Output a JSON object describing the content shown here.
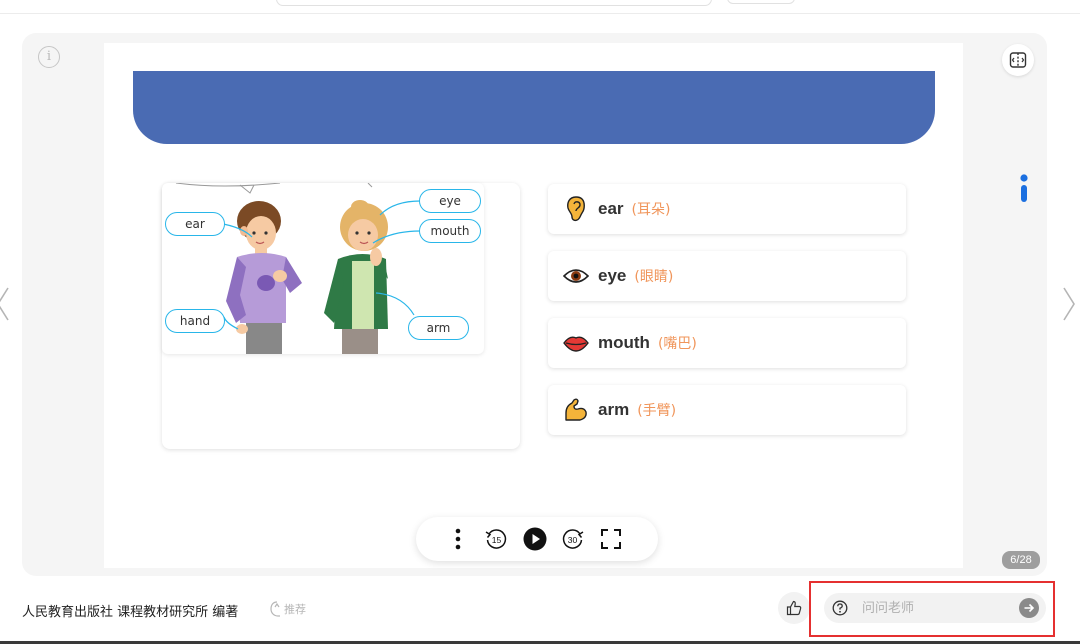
{
  "slide": {
    "callouts": {
      "ear": "ear",
      "eye": "eye",
      "mouth": "mouth",
      "hand": "hand",
      "arm": "arm"
    },
    "vocab": [
      {
        "icon": "ear-icon",
        "word": "ear",
        "cn": "(耳朵)"
      },
      {
        "icon": "eye-icon",
        "word": "eye",
        "cn": "(眼睛)"
      },
      {
        "icon": "mouth-icon",
        "word": "mouth",
        "cn": "(嘴巴)"
      },
      {
        "icon": "flexed-arm-icon",
        "word": "arm",
        "cn": "(手臂)"
      }
    ]
  },
  "player": {
    "rewind_label": "15",
    "forward_label": "30"
  },
  "pagination": {
    "label": "6/28"
  },
  "footer": {
    "publisher": "人民教育出版社 课程教材研究所 编著",
    "recommend_label": "推荐"
  },
  "ask": {
    "placeholder": "问问老师"
  },
  "colors": {
    "banner": "#4a6bb3",
    "callout_border": "#29b6e9",
    "chinese_gloss": "#f0955a",
    "highlight_box": "#e53030"
  }
}
